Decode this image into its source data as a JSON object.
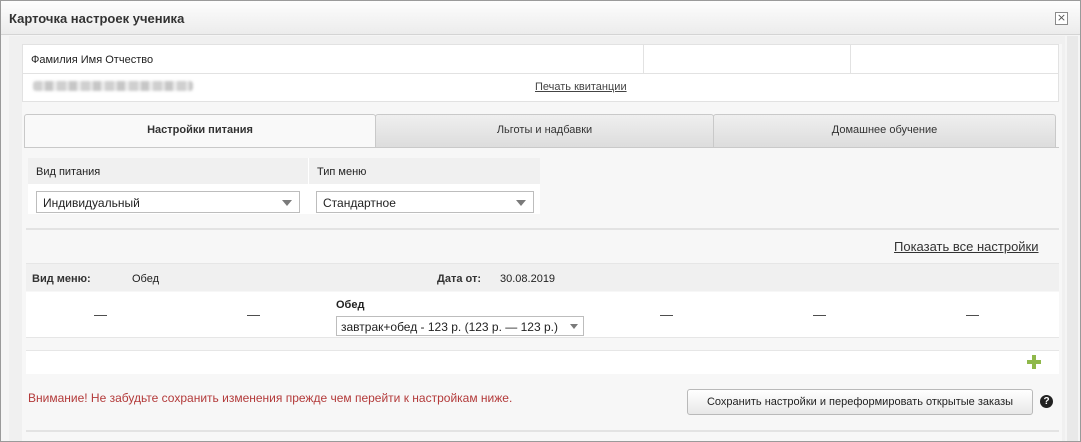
{
  "dialog": {
    "title": "Карточка настроек ученика",
    "close_symbol": "×"
  },
  "student": {
    "fio_header": "Фамилия Имя Отчество",
    "print_link": "Печать квитанции"
  },
  "tabs": [
    {
      "label": "Настройки питания",
      "active": true
    },
    {
      "label": "Льготы и надбавки",
      "active": false
    },
    {
      "label": "Домашнее обучение",
      "active": false
    }
  ],
  "form": {
    "food_type_label": "Вид питания",
    "food_type_value": "Индивидуальный",
    "menu_type_label": "Тип меню",
    "menu_type_value": "Стандартное"
  },
  "show_all_settings": "Показать все настройки",
  "menu": {
    "view_label": "Вид меню:",
    "view_value": "Обед",
    "date_label": "Дата от:",
    "date_value": "30.08.2019",
    "dash": "—",
    "meal_label": "Обед",
    "meal_value": "завтрак+обед - 123 р. (123 р. — 123 р.)"
  },
  "warning": "Внимание! Не забудьте сохранить изменения прежде чем перейти к настройкам ниже.",
  "save_button": "Сохранить настройки и переформировать открытые заказы",
  "help_symbol": "?",
  "colors": {
    "warning": "#b33a3a",
    "add_icon": "#8fb84a"
  }
}
